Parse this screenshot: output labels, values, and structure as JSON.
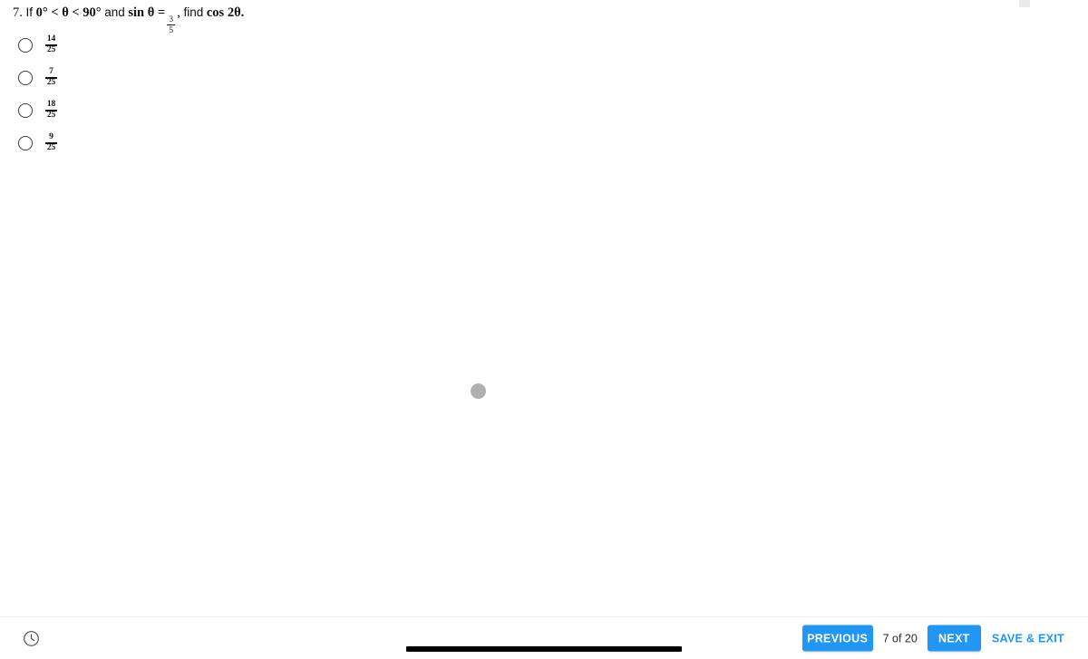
{
  "question": {
    "number": "7.",
    "prefix": "If",
    "range": "0° < θ < 90°",
    "conjunction": "and",
    "trig_expr": "sin θ =",
    "given_value": {
      "numerator": "3",
      "denominator": "5"
    },
    "comma": ",",
    "instruction": "find",
    "target_expr": "cos 2θ."
  },
  "options": [
    {
      "id": "option-a",
      "numerator": "14",
      "denominator": "25",
      "selected": false
    },
    {
      "id": "option-b",
      "numerator": "7",
      "denominator": "25",
      "selected": false
    },
    {
      "id": "option-c",
      "numerator": "18",
      "denominator": "25",
      "selected": false
    },
    {
      "id": "option-d",
      "numerator": "9",
      "denominator": "25",
      "selected": false
    }
  ],
  "loading": {
    "visible": true,
    "color": "#b0b0b0"
  },
  "footer": {
    "timer_icon": "clock-icon",
    "previous_label": "PREVIOUS",
    "page_counter": "7 of 20",
    "next_label": "NEXT",
    "save_exit_label": "SAVE & EXIT",
    "accent_color": "#2196f3",
    "progress_bar_color": "#000000"
  }
}
